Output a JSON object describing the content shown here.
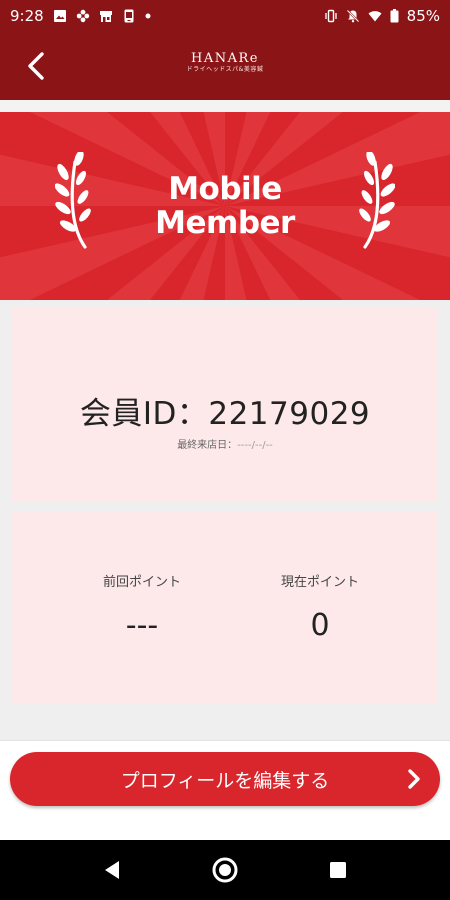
{
  "status_bar": {
    "time": "9:28",
    "battery": "85%",
    "left_icons": [
      "image-icon",
      "settings-flower-icon",
      "store-icon",
      "phone-app-icon",
      "dot-icon"
    ],
    "right_icons": [
      "vibrate-icon",
      "mute-icon",
      "wifi-icon",
      "battery-icon"
    ]
  },
  "header": {
    "logo_name": "HANARe",
    "logo_sub": "ドライヘッドスパ&美容鍼",
    "back_icon": "chevron-left-icon"
  },
  "banner": {
    "title_line1": "Mobile",
    "title_line2": "Member",
    "colors": {
      "base": "#d8262c",
      "ray": "#e0353a"
    }
  },
  "member": {
    "id_label": "会員ID：",
    "id_value": "22179029",
    "last_visit_label": "最終来店日：",
    "last_visit_value": "----/--/--"
  },
  "points": {
    "prev_label": "前回ポイント",
    "prev_value": "---",
    "current_label": "現在ポイント",
    "current_value": "0"
  },
  "footer": {
    "edit_button_label": "プロフィールを編集する",
    "edit_button_icon": "chevron-right-icon"
  },
  "colors": {
    "header": "#8b1417",
    "accent": "#d8262c",
    "card": "#fde9ea"
  }
}
